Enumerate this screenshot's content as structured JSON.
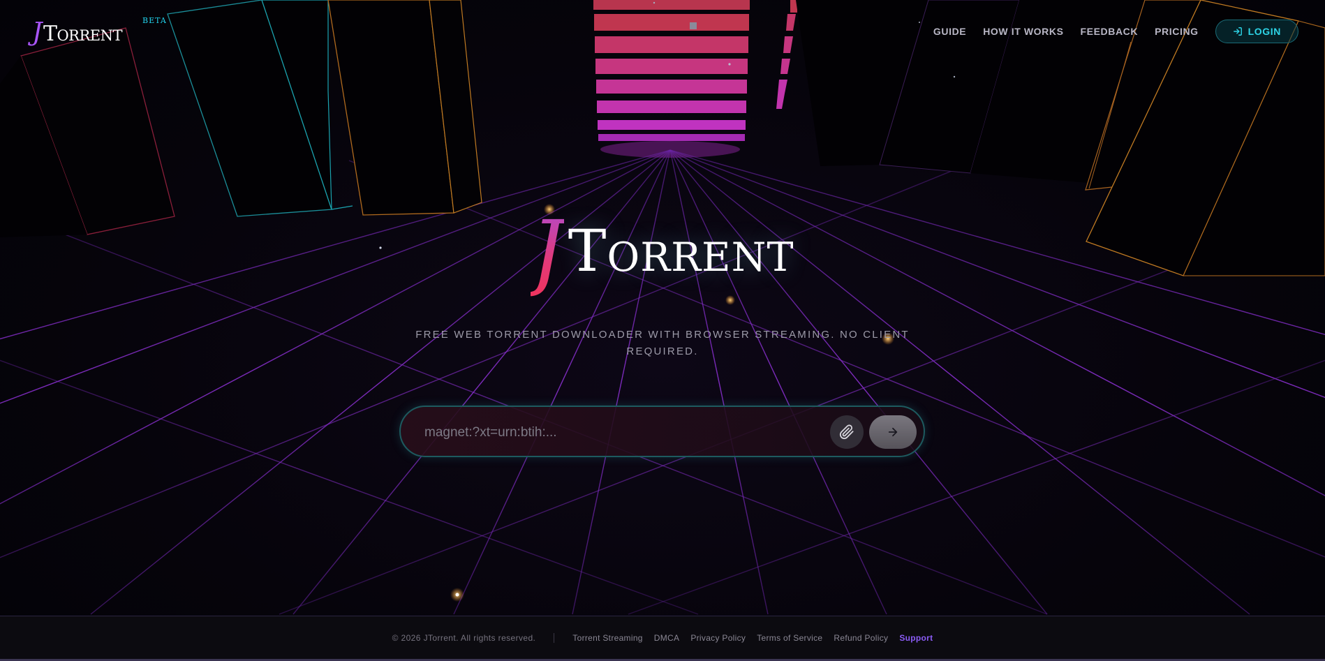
{
  "brand": {
    "logo_initial": "J",
    "logo_word": "Torrent",
    "beta_label": "BETA"
  },
  "nav": {
    "items": [
      {
        "label": "GUIDE"
      },
      {
        "label": "HOW IT WORKS"
      },
      {
        "label": "FEEDBACK"
      },
      {
        "label": "PRICING"
      }
    ],
    "login_label": "LOGIN",
    "login_icon": "login-icon"
  },
  "hero": {
    "title_initial": "J",
    "title_word": "Torrent",
    "subtitle": "FREE WEB TORRENT DOWNLOADER WITH BROWSER STREAMING. NO CLIENT REQUIRED."
  },
  "search": {
    "value": "",
    "placeholder": "magnet:?xt=urn:btih:...",
    "attach_icon": "paperclip-icon",
    "submit_icon": "arrow-right-icon"
  },
  "footer": {
    "copyright": "© 2026 JTorrent. All rights reserved.",
    "links": [
      {
        "label": "Torrent Streaming"
      },
      {
        "label": "DMCA"
      },
      {
        "label": "Privacy Policy"
      },
      {
        "label": "Terms of Service"
      },
      {
        "label": "Refund Policy"
      },
      {
        "label": "Support"
      }
    ]
  },
  "colors": {
    "accent_cyan": "#22d3ee",
    "accent_purple": "#a855f7",
    "grid_purple": "#7c2fc0",
    "support_link": "#8b5cf6"
  }
}
